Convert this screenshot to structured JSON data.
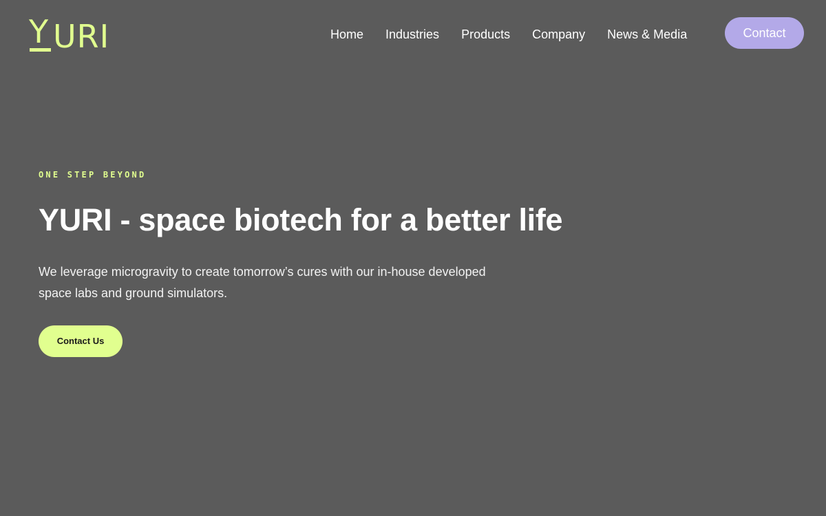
{
  "header": {
    "logo": {
      "first_letter": "Y",
      "rest": "URI",
      "color": "#e1ff8f"
    },
    "nav": {
      "items": [
        {
          "label": "Home"
        },
        {
          "label": "Industries"
        },
        {
          "label": "Products"
        },
        {
          "label": "Company"
        },
        {
          "label": "News & Media"
        }
      ]
    },
    "contact_label": "Contact"
  },
  "hero": {
    "eyebrow": "ONE STEP BEYOND",
    "headline": "YURI - space biotech for a better life",
    "subtext": "We leverage microgravity to create tomorrow’s cures with our in-house developed space labs and ground simulators.",
    "cta_label": "Contact Us"
  },
  "colors": {
    "background": "#5b5b5b",
    "accent_lime": "#e1ff8f",
    "accent_lavender": "#b3a9e8",
    "text": "#ffffff"
  }
}
